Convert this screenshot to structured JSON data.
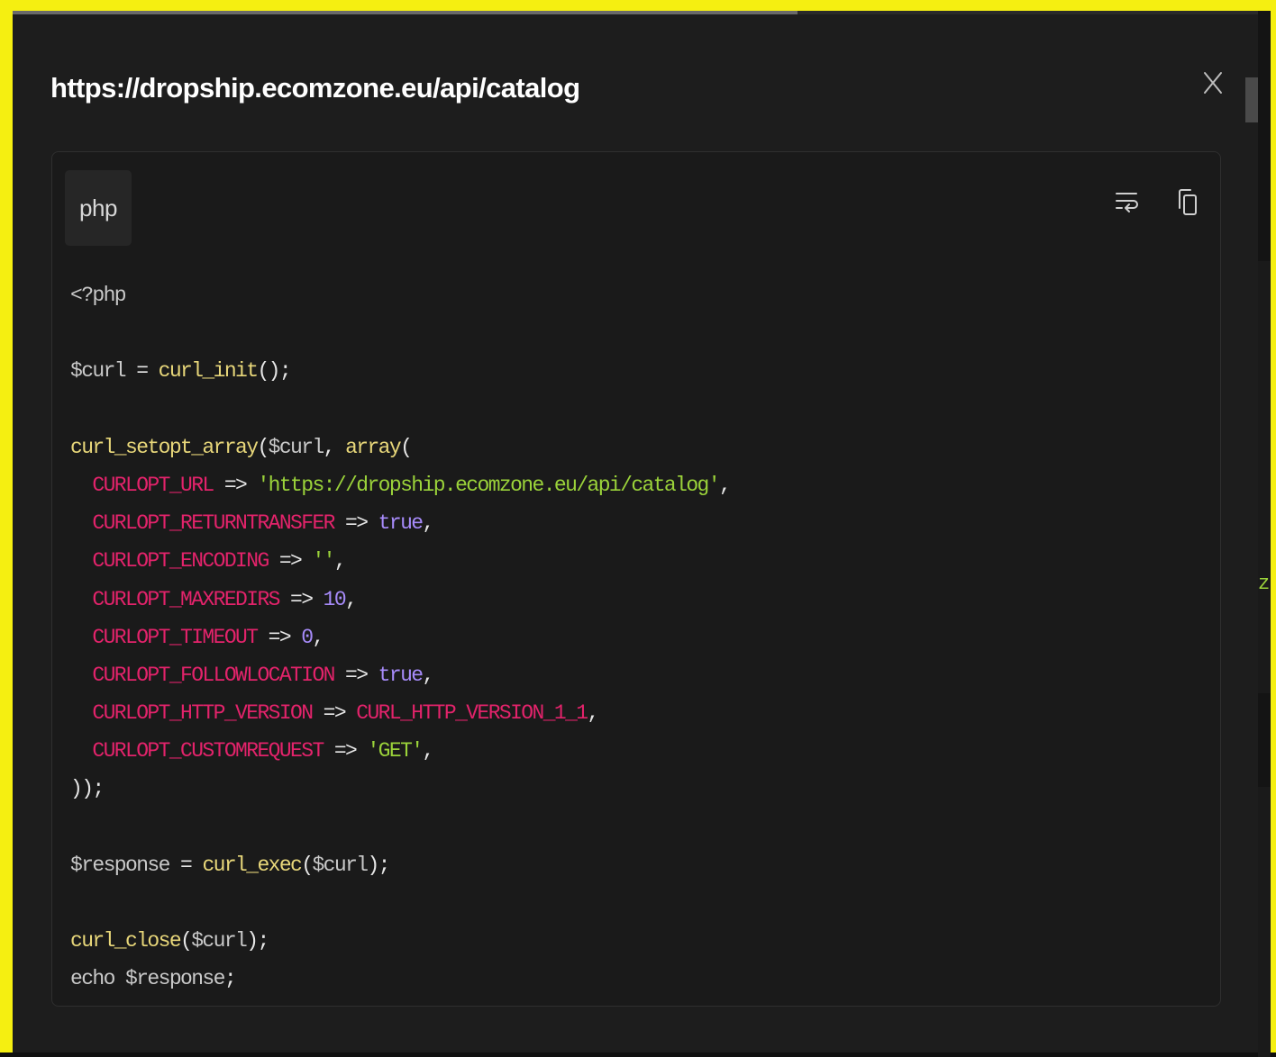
{
  "modal": {
    "title": "https://dropship.ecomzone.eu/api/catalog",
    "close_label": "X",
    "progress": 0.63
  },
  "code_block": {
    "language": "php",
    "icons": {
      "wrap": "wrap-text-icon",
      "copy": "copy-icon"
    },
    "lines": [
      [
        {
          "t": "plain",
          "v": "<?php"
        }
      ],
      [],
      [
        {
          "t": "var",
          "v": "$curl"
        },
        {
          "t": "punct",
          "v": " = "
        },
        {
          "t": "fn",
          "v": "curl_init"
        },
        {
          "t": "punct",
          "v": "();"
        }
      ],
      [],
      [
        {
          "t": "fn",
          "v": "curl_setopt_array"
        },
        {
          "t": "punct",
          "v": "("
        },
        {
          "t": "var",
          "v": "$curl"
        },
        {
          "t": "punct",
          "v": ", "
        },
        {
          "t": "fn",
          "v": "array"
        },
        {
          "t": "punct",
          "v": "("
        }
      ],
      [
        {
          "t": "plain",
          "v": "  "
        },
        {
          "t": "const",
          "v": "CURLOPT_URL"
        },
        {
          "t": "punct",
          "v": " => "
        },
        {
          "t": "str",
          "v": "'https://dropship.ecomzone.eu/api/catalog'"
        },
        {
          "t": "punct",
          "v": ","
        }
      ],
      [
        {
          "t": "plain",
          "v": "  "
        },
        {
          "t": "const",
          "v": "CURLOPT_RETURNTRANSFER"
        },
        {
          "t": "punct",
          "v": " => "
        },
        {
          "t": "bool",
          "v": "true"
        },
        {
          "t": "punct",
          "v": ","
        }
      ],
      [
        {
          "t": "plain",
          "v": "  "
        },
        {
          "t": "const",
          "v": "CURLOPT_ENCODING"
        },
        {
          "t": "punct",
          "v": " => "
        },
        {
          "t": "str",
          "v": "''"
        },
        {
          "t": "punct",
          "v": ","
        }
      ],
      [
        {
          "t": "plain",
          "v": "  "
        },
        {
          "t": "const",
          "v": "CURLOPT_MAXREDIRS"
        },
        {
          "t": "punct",
          "v": " => "
        },
        {
          "t": "num",
          "v": "10"
        },
        {
          "t": "punct",
          "v": ","
        }
      ],
      [
        {
          "t": "plain",
          "v": "  "
        },
        {
          "t": "const",
          "v": "CURLOPT_TIMEOUT"
        },
        {
          "t": "punct",
          "v": " => "
        },
        {
          "t": "num",
          "v": "0"
        },
        {
          "t": "punct",
          "v": ","
        }
      ],
      [
        {
          "t": "plain",
          "v": "  "
        },
        {
          "t": "const",
          "v": "CURLOPT_FOLLOWLOCATION"
        },
        {
          "t": "punct",
          "v": " => "
        },
        {
          "t": "bool",
          "v": "true"
        },
        {
          "t": "punct",
          "v": ","
        }
      ],
      [
        {
          "t": "plain",
          "v": "  "
        },
        {
          "t": "const",
          "v": "CURLOPT_HTTP_VERSION"
        },
        {
          "t": "punct",
          "v": " => "
        },
        {
          "t": "const",
          "v": "CURL_HTTP_VERSION_1_1"
        },
        {
          "t": "punct",
          "v": ","
        }
      ],
      [
        {
          "t": "plain",
          "v": "  "
        },
        {
          "t": "const",
          "v": "CURLOPT_CUSTOMREQUEST"
        },
        {
          "t": "punct",
          "v": " => "
        },
        {
          "t": "str",
          "v": "'GET'"
        },
        {
          "t": "punct",
          "v": ","
        }
      ],
      [
        {
          "t": "punct",
          "v": "));"
        }
      ],
      [],
      [
        {
          "t": "var",
          "v": "$response"
        },
        {
          "t": "punct",
          "v": " = "
        },
        {
          "t": "fn",
          "v": "curl_exec"
        },
        {
          "t": "punct",
          "v": "("
        },
        {
          "t": "var",
          "v": "$curl"
        },
        {
          "t": "punct",
          "v": ");"
        }
      ],
      [],
      [
        {
          "t": "fn",
          "v": "curl_close"
        },
        {
          "t": "punct",
          "v": "("
        },
        {
          "t": "var",
          "v": "$curl"
        },
        {
          "t": "punct",
          "v": ");"
        }
      ],
      [
        {
          "t": "plain",
          "v": "echo "
        },
        {
          "t": "var",
          "v": "$response"
        },
        {
          "t": "punct",
          "v": ";"
        }
      ]
    ]
  },
  "background": {
    "side_letter": "z"
  },
  "colors": {
    "frame": "#f5ef11",
    "modal_bg": "#1d1d1d",
    "panel_bg": "#1a1a1a",
    "function": "#e8d77a",
    "constant": "#e3236b",
    "string": "#9bd33a",
    "keyword_value": "#a78bfa"
  }
}
